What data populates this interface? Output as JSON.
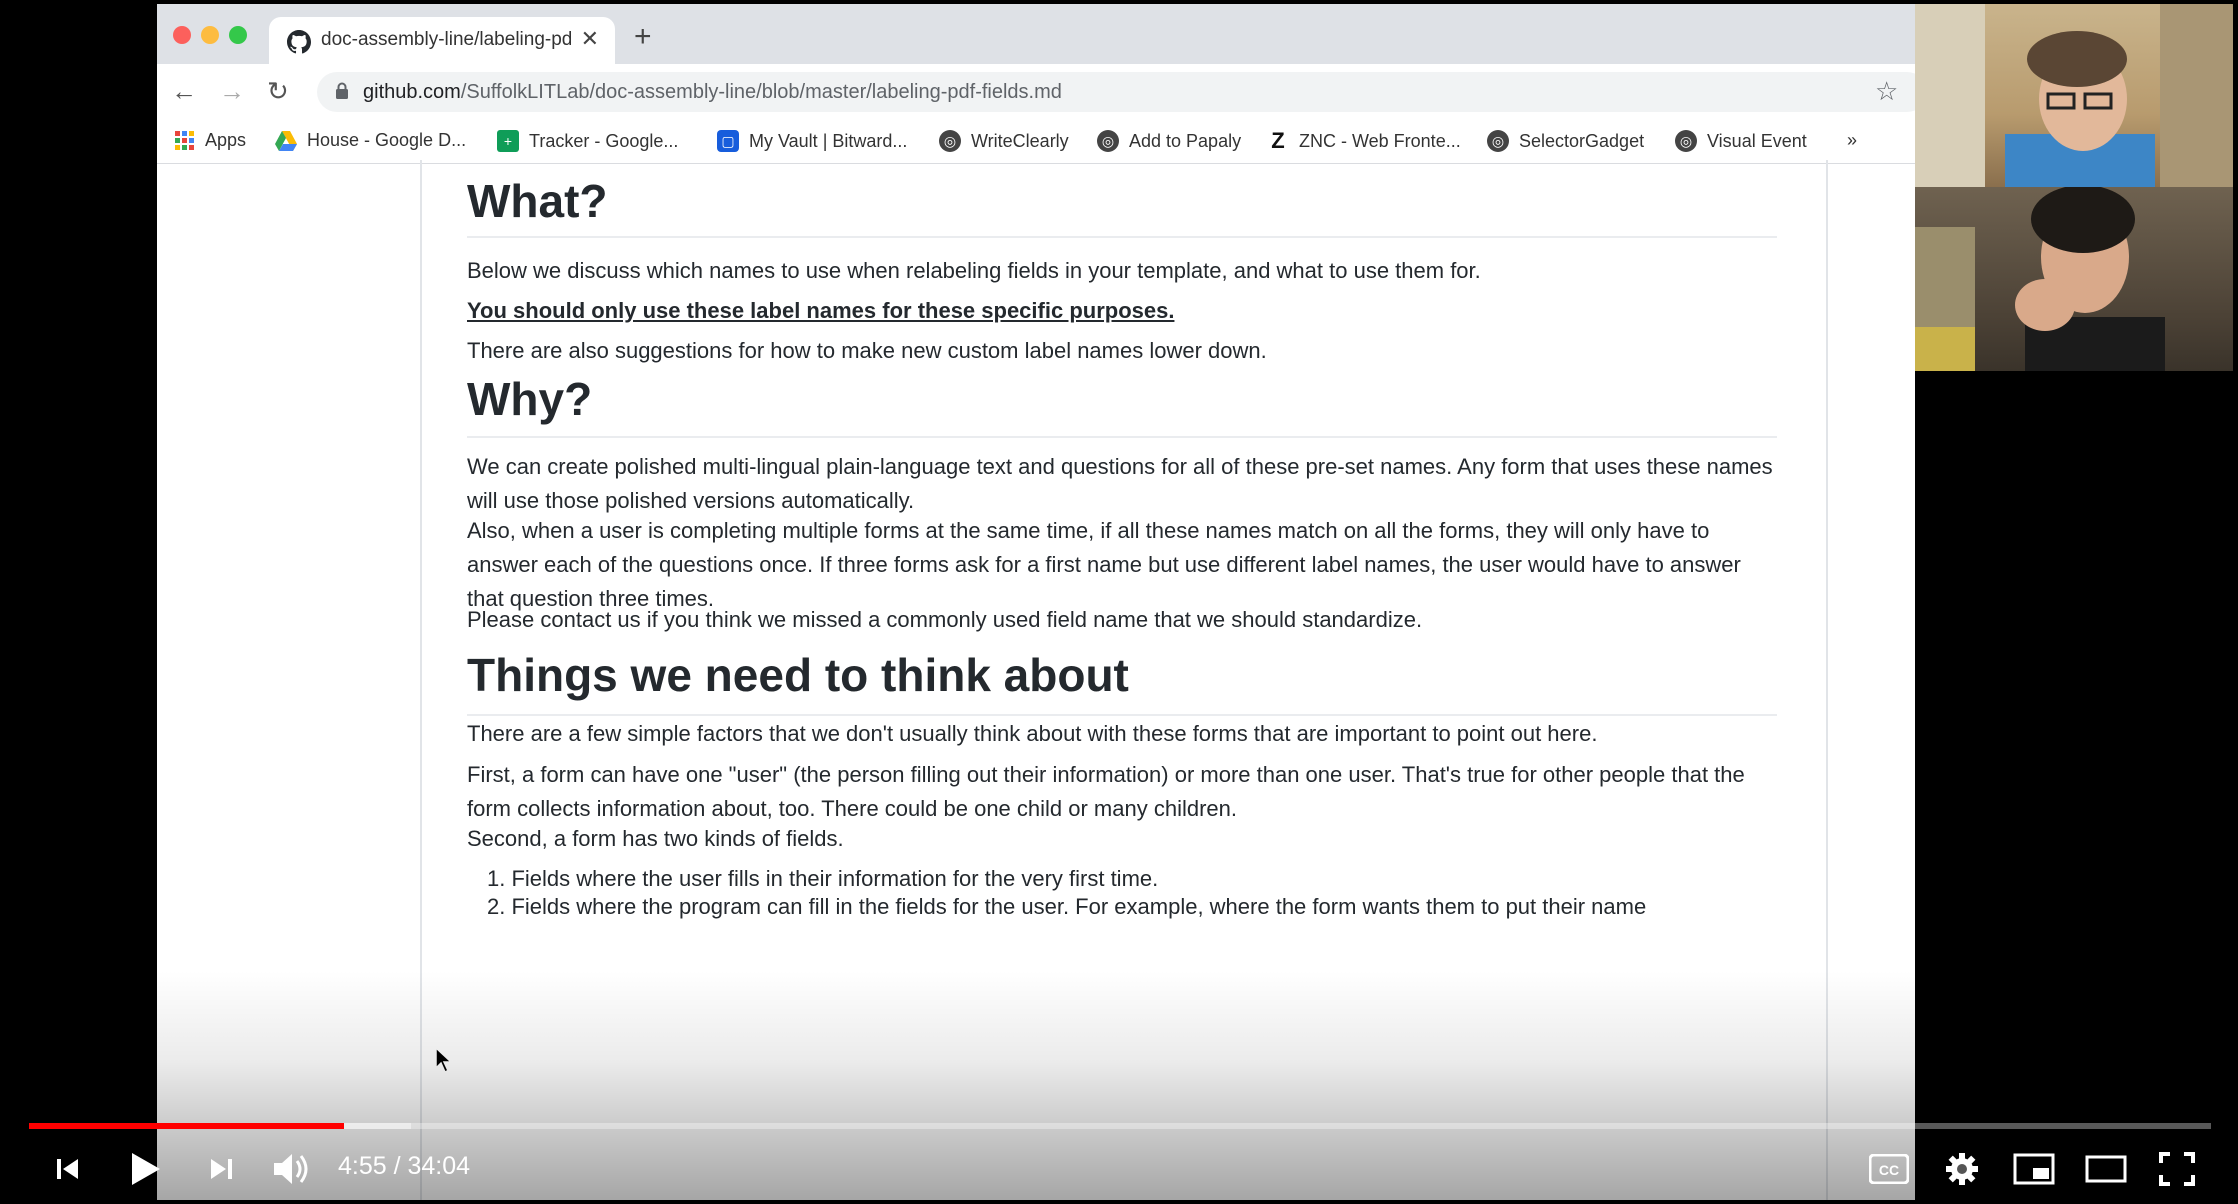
{
  "browser": {
    "tab_title": "doc-assembly-line/labeling-pd",
    "url_domain": "github.com",
    "url_path": "/SuffolkLITLab/doc-assembly-line/blob/master/labeling-pdf-fields.md",
    "bookmarks": [
      {
        "label": "Apps",
        "icon": "apps-grid-icon"
      },
      {
        "label": "House - Google D...",
        "icon": "google-drive-icon"
      },
      {
        "label": "Tracker - Google...",
        "icon": "google-sheets-icon"
      },
      {
        "label": "My Vault | Bitward...",
        "icon": "bitwarden-icon"
      },
      {
        "label": "WriteClearly",
        "icon": "globe-icon"
      },
      {
        "label": "Add to Papaly",
        "icon": "globe-icon"
      },
      {
        "label": "ZNC - Web Fronte...",
        "icon": "znc-icon"
      },
      {
        "label": "SelectorGadget",
        "icon": "globe-icon"
      },
      {
        "label": "Visual Event",
        "icon": "globe-icon"
      }
    ],
    "overflow_label": "»"
  },
  "content": {
    "h_what": "What?",
    "p_what_1": "Below we discuss which names to use when relabeling fields in your template, and what to use them for.",
    "p_what_2": "You should only use these label names for these specific purposes.",
    "p_what_3": "There are also suggestions for how to make new custom label names lower down.",
    "h_why": "Why?",
    "p_why_1": "We can create polished multi-lingual plain-language text and questions for all of these pre-set names. Any form that uses these names will use those polished versions automatically.",
    "p_why_2": "Also, when a user is completing multiple forms at the same time, if all these names match on all the forms, they will only have to answer each of the questions once. If three forms ask for a first name but use different label names, the user would have to answer that question three times.",
    "p_why_3": "Please contact us if you think we missed a commonly used field name that we should standardize.",
    "h_things": "Things we need to think about",
    "p_things_1": "There are a few simple factors that we don't usually think about with these forms that are important to point out here.",
    "p_things_2": "First, a form can have one \"user\" (the person filling out their information) or more than one user. That's true for other people that the form collects information about, too. There could be one child or many children.",
    "p_things_3": "Second, a form has two kinds of fields.",
    "list_1": "1. Fields where the user fills in their information for the very first time.",
    "list_2": "2. Fields where the program can fill in the fields for the user. For example, where the form wants them to put their name"
  },
  "player": {
    "current_time": "4:55",
    "duration": "34:04",
    "time_display": "4:55 / 34:04",
    "progress_fraction": 0.1443,
    "buffered_fraction": 0.175,
    "cc_label": "CC",
    "accent_color": "#ff0000"
  }
}
